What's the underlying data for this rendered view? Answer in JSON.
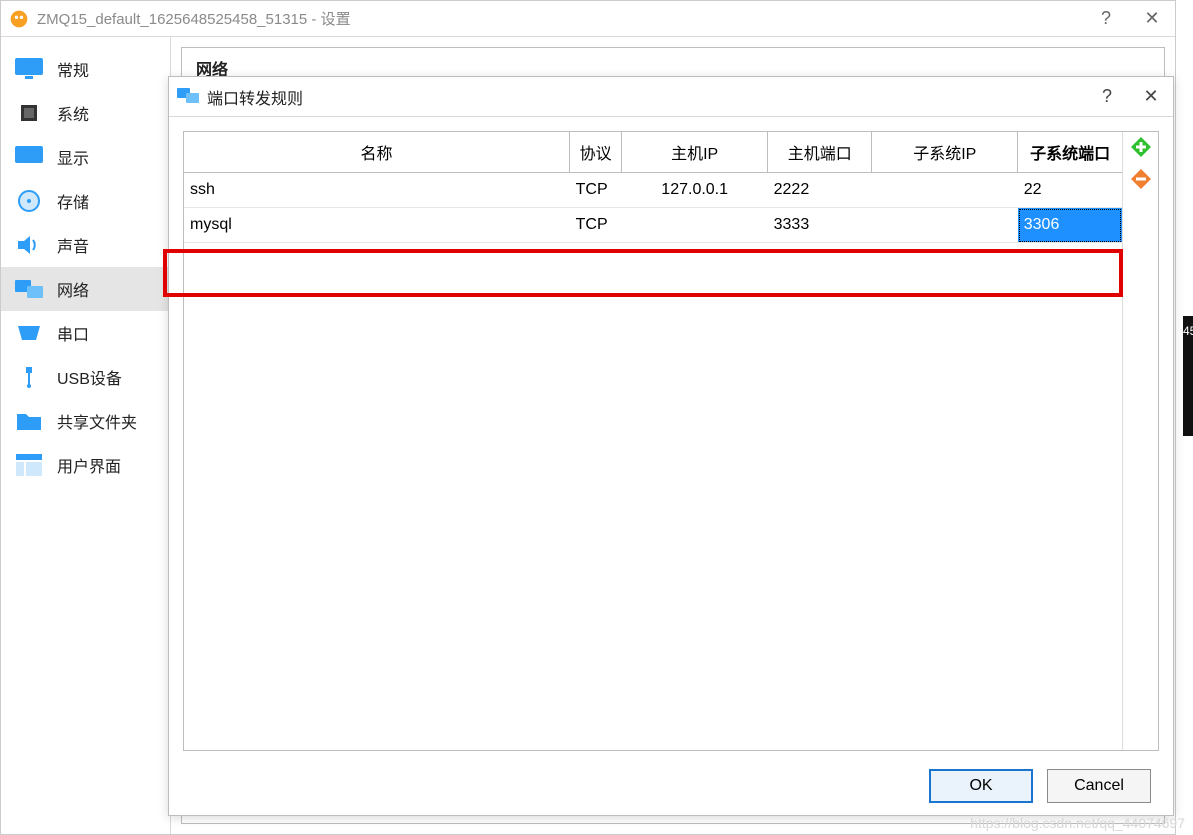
{
  "outer": {
    "title": "ZMQ15_default_1625648525458_51315 - 设置",
    "help_glyph": "?",
    "close_glyph": "✕"
  },
  "sidebar": {
    "items": [
      {
        "label": "常规"
      },
      {
        "label": "系统"
      },
      {
        "label": "显示"
      },
      {
        "label": "存储"
      },
      {
        "label": "声音"
      },
      {
        "label": "网络"
      },
      {
        "label": "串口"
      },
      {
        "label": "USB设备"
      },
      {
        "label": "共享文件夹"
      },
      {
        "label": "用户界面"
      }
    ],
    "active_index": 5
  },
  "section": {
    "title": "网络"
  },
  "dialog": {
    "title": "端口转发规则",
    "help_glyph": "?",
    "close_glyph": "✕",
    "ok_label": "OK",
    "cancel_label": "Cancel"
  },
  "table": {
    "headers": {
      "name": "名称",
      "protocol": "协议",
      "host_ip": "主机IP",
      "host_port": "主机端口",
      "guest_ip": "子系统IP",
      "guest_port": "子系统端口"
    },
    "rows": [
      {
        "name": "ssh",
        "protocol": "TCP",
        "host_ip": "127.0.0.1",
        "host_port": "2222",
        "guest_ip": "",
        "guest_port": "22"
      },
      {
        "name": "mysql",
        "protocol": "TCP",
        "host_ip": "",
        "host_port": "3333",
        "guest_ip": "",
        "guest_port": "3306"
      }
    ],
    "selected": {
      "row": 1,
      "col": "guest_port"
    }
  },
  "watermark": "https://blog.csdn.net/qq_44074697",
  "behind_text": "45"
}
